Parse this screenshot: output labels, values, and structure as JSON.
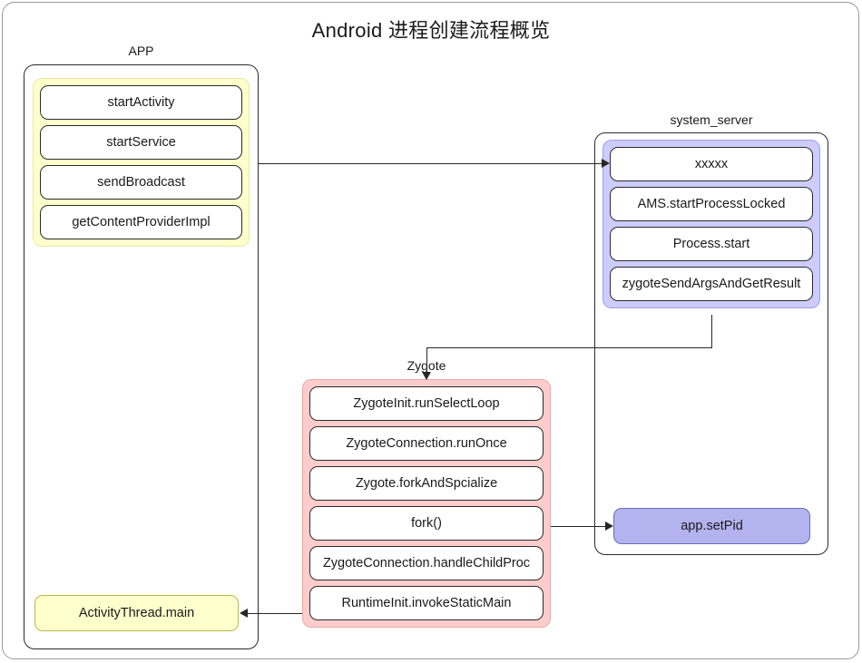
{
  "diagram": {
    "title": "Android 进程创建流程概览"
  },
  "lanes": {
    "app": {
      "label": "APP",
      "accent": "#ffffcc",
      "nodes": [
        {
          "label": "startActivity"
        },
        {
          "label": "startService"
        },
        {
          "label": "sendBroadcast"
        },
        {
          "label": "getContentProviderImpl"
        }
      ],
      "result_node": {
        "label": "ActivityThread.main",
        "fill": "#ffffcc"
      }
    },
    "system_server": {
      "label": "system_server",
      "accent": "#ccccff",
      "nodes": [
        {
          "label": "xxxxx"
        },
        {
          "label": "AMS.startProcessLocked"
        },
        {
          "label": "Process.start"
        },
        {
          "label": "zygoteSendArgsAndGetResult"
        }
      ],
      "result_node": {
        "label": "app.setPid",
        "fill": "#b3b3f0"
      }
    },
    "zygote": {
      "label": "Zygote",
      "accent": "#ffcccc",
      "nodes": [
        {
          "label": "ZygoteInit.runSelectLoop"
        },
        {
          "label": "ZygoteConnection.runOnce"
        },
        {
          "label": "Zygote.forkAndSpcialize"
        },
        {
          "label": "fork()"
        },
        {
          "label": "ZygoteConnection.handleChildProc"
        },
        {
          "label": "RuntimeInit.invokeStaticMain"
        }
      ]
    }
  },
  "edges": [
    {
      "name": "app-to-system-server",
      "from": "APP",
      "to": "xxxxx",
      "direction": "right"
    },
    {
      "name": "zygote-send-args-to-zygote",
      "from": "zygoteSendArgsAndGetResult",
      "to": "Zygote",
      "direction": "down"
    },
    {
      "name": "fork-to-app-setpid",
      "from": "fork()",
      "to": "app.setPid",
      "direction": "right"
    },
    {
      "name": "invoke-static-main-to-activitythread-main",
      "from": "RuntimeInit.invokeStaticMain",
      "to": "ActivityThread.main",
      "direction": "left"
    }
  ],
  "colors": {
    "stroke": "#262626",
    "lane_border": "#2b2b2b",
    "background": "#ffffff"
  }
}
